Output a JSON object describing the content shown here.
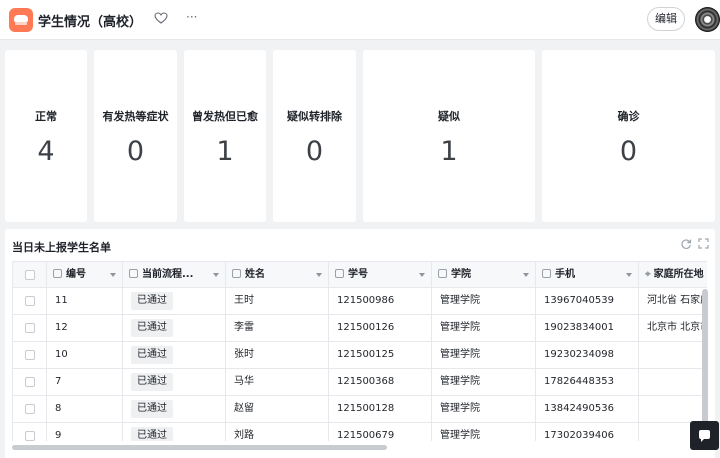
{
  "app": {
    "title": "学生情况（高校）",
    "edit_label": "编辑"
  },
  "cards": [
    {
      "label": "正常",
      "value": "4"
    },
    {
      "label": "有发热等症状",
      "value": "0"
    },
    {
      "label": "曾发热但已愈",
      "value": "1"
    },
    {
      "label": "疑似转排除",
      "value": "0"
    },
    {
      "label": "疑似",
      "value": "1"
    },
    {
      "label": "确诊",
      "value": "0"
    }
  ],
  "table": {
    "title": "当日未上报学生名单",
    "columns": [
      "编号",
      "当前流程...",
      "姓名",
      "学号",
      "学院",
      "手机",
      "家庭所在地"
    ],
    "rows": [
      {
        "id": "11",
        "status": "已通过",
        "name": "王时",
        "student_no": "121500986",
        "college": "管理学院",
        "phone": "13967040539",
        "home": "河北省 石家庄"
      },
      {
        "id": "12",
        "status": "已通过",
        "name": "李雷",
        "student_no": "121500126",
        "college": "管理学院",
        "phone": "19023834001",
        "home": "北京市 北京市"
      },
      {
        "id": "10",
        "status": "已通过",
        "name": "张时",
        "student_no": "121500125",
        "college": "管理学院",
        "phone": "19230234098",
        "home": ""
      },
      {
        "id": "7",
        "status": "已通过",
        "name": "马华",
        "student_no": "121500368",
        "college": "管理学院",
        "phone": "17826448353",
        "home": ""
      },
      {
        "id": "8",
        "status": "已通过",
        "name": "赵留",
        "student_no": "121500128",
        "college": "管理学院",
        "phone": "13842490536",
        "home": ""
      },
      {
        "id": "9",
        "status": "已通过",
        "name": "刘路",
        "student_no": "121500679",
        "college": "管理学院",
        "phone": "17302039406",
        "home": ""
      }
    ]
  },
  "icons": {
    "favorite": "heart-outline-icon",
    "more": "more-dots-icon",
    "refresh": "refresh-icon",
    "expand": "expand-icon",
    "chat": "chat-icon"
  },
  "colors": {
    "brand": "#ff7a55",
    "text": "#1f2329",
    "value": "#3c4047"
  }
}
